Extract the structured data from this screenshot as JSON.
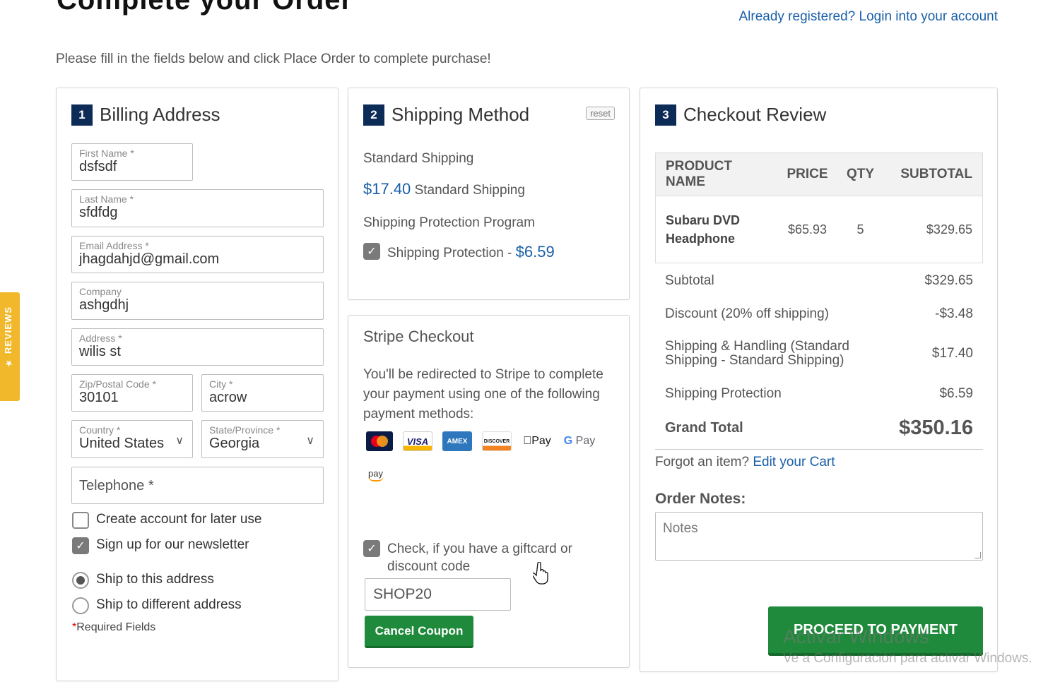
{
  "header": {
    "title": "Complete your Order",
    "login_link": "Already registered? Login into your account",
    "intro": "Please fill in the fields below and click Place Order to complete purchase!"
  },
  "side_tab": {
    "label": "★ REVIEWS"
  },
  "billing": {
    "step": "1",
    "title": "Billing Address",
    "first_name": {
      "label": "First Name",
      "value": "dsfsdf"
    },
    "last_name": {
      "label": "Last Name",
      "value": "sfdfdg"
    },
    "email": {
      "label": "Email Address",
      "value": "jhagdahjd@gmail.com"
    },
    "company": {
      "label": "Company",
      "value": "ashgdhj"
    },
    "address": {
      "label": "Address",
      "value": "wilis st"
    },
    "zip": {
      "label": "Zip/Postal Code",
      "value": "30101"
    },
    "city": {
      "label": "City",
      "value": "acrow"
    },
    "country": {
      "label": "Country",
      "value": "United States"
    },
    "state": {
      "label": "State/Province",
      "value": "Georgia"
    },
    "telephone": {
      "placeholder": "Telephone *"
    },
    "create_account": {
      "label": "Create account for later use",
      "checked": false
    },
    "newsletter": {
      "label": "Sign up for our newsletter",
      "checked": true
    },
    "ship_same": {
      "label": "Ship to this address",
      "selected": true
    },
    "ship_different": {
      "label": "Ship to different address",
      "selected": false
    },
    "required_note": "Required Fields",
    "required_star": "*"
  },
  "shipping": {
    "step": "2",
    "title": "Shipping Method",
    "reset_label": "reset",
    "method_group": "Standard Shipping",
    "method_price": "$17.40",
    "method_name": "Standard Shipping",
    "protection_group": "Shipping Protection Program",
    "protection_label": "Shipping Protection - ",
    "protection_price": "$6.59",
    "protection_checked": true
  },
  "stripe": {
    "title": "Stripe Checkout",
    "description": "You'll be redirected to Stripe to complete your payment using one of the following payment methods:",
    "methods": [
      "mastercard-icon",
      "visa-icon",
      "amex-icon",
      "discover-icon",
      "apple-pay-icon",
      "google-pay-icon",
      "amazon-pay-icon"
    ],
    "visa_text": "VISA",
    "amex_text": "AMEX",
    "discover_text": "DISCOVER",
    "applepay_text": "Pay",
    "gpay_text": "Pay",
    "amazon_text": "pay",
    "giftcard_label": "Check, if you have a giftcard or discount code",
    "giftcard_checked": true,
    "coupon_value": "SHOP20",
    "cancel_coupon": "Cancel Coupon"
  },
  "review": {
    "step": "3",
    "title": "Checkout Review",
    "columns": [
      "PRODUCT NAME",
      "PRICE",
      "QTY",
      "SUBTOTAL"
    ],
    "items": [
      {
        "name": "Subaru DVD Headphone",
        "price": "$65.93",
        "qty": "5",
        "subtotal": "$329.65"
      }
    ],
    "subtotal_label": "Subtotal",
    "subtotal_value": "$329.65",
    "discount_label": "Discount (20% off shipping)",
    "discount_value": "-$3.48",
    "shipping_label": "Shipping & Handling (Standard Shipping - Standard Shipping)",
    "shipping_value": "$17.40",
    "protection_label": "Shipping Protection",
    "protection_value": "$6.59",
    "grand_label": "Grand Total",
    "grand_value": "$350.16",
    "forgot_text": "Forgot an item? ",
    "edit_cart": "Edit your Cart",
    "notes_label": "Order Notes:",
    "notes_placeholder": "Notes",
    "proceed": "PROCEED TO PAYMENT"
  },
  "watermark": {
    "line1": "Activar Windows",
    "line2": "Ve a Configuración para activar Windows."
  },
  "colors": {
    "accent": "#1a5fa8",
    "step_badge": "#0c2b57",
    "button_green": "#1f8a3b",
    "reviews_tab": "#f2b82b"
  }
}
